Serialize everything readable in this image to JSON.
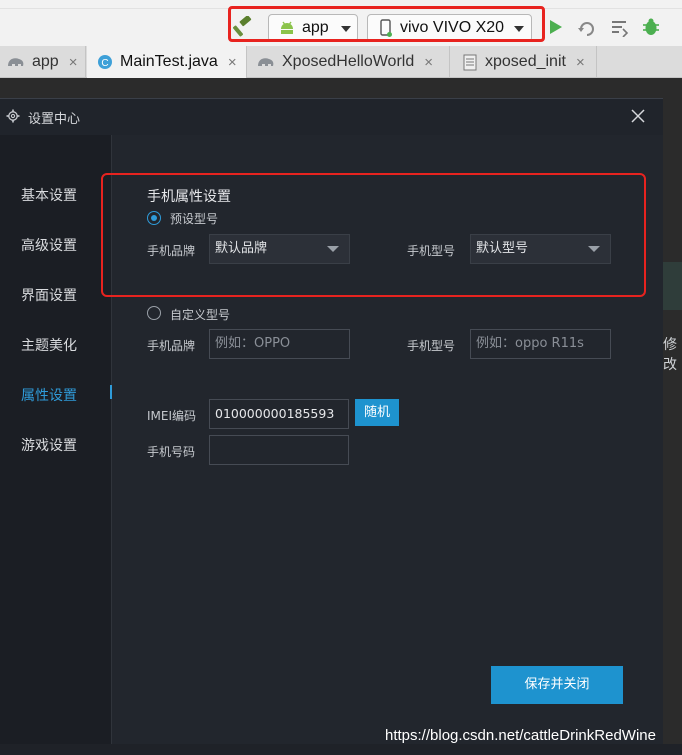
{
  "ide": {
    "run_config": "app",
    "device": "vivo VIVO X20",
    "tabs": [
      {
        "label": "app",
        "close": "×"
      },
      {
        "label": "MainTest.java",
        "close": "×"
      },
      {
        "label": "XposedHelloWorld",
        "close": "×"
      },
      {
        "label": "xposed_init",
        "close": "×"
      }
    ]
  },
  "dialog": {
    "title": "设置中心",
    "nav": [
      {
        "label": "基本设置"
      },
      {
        "label": "高级设置"
      },
      {
        "label": "界面设置"
      },
      {
        "label": "主题美化"
      },
      {
        "label": "属性设置"
      },
      {
        "label": "游戏设置"
      }
    ],
    "active_nav": "属性设置",
    "phone": {
      "section_title": "手机属性设置",
      "preset_radio": "预设型号",
      "custom_radio": "自定义型号",
      "brand_label": "手机品牌",
      "model_label": "手机型号",
      "preset_brand": "默认品牌",
      "preset_model": "默认型号",
      "custom_brand_placeholder": "例如：OPPO",
      "custom_model_placeholder": "例如：oppo R11s",
      "imei_label": "IMEI编码",
      "imei_value": "010000000185593",
      "random_button": "随机",
      "phone_number_label": "手机号码",
      "phone_number_value": ""
    },
    "save_button": "保存并关闭"
  },
  "edge_text": "修改",
  "watermark": "https://blog.csdn.net/cattleDrinkRedWine",
  "colors": {
    "accent": "#1e93cf",
    "annotation_red": "#e8231f"
  }
}
